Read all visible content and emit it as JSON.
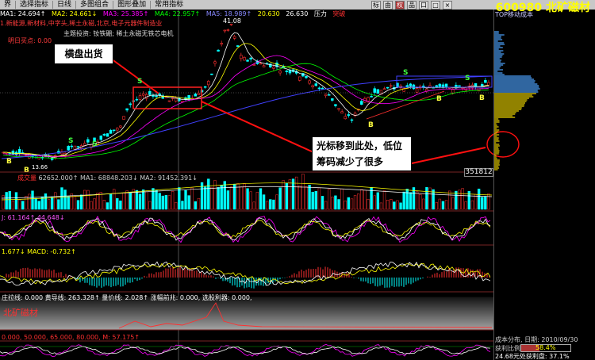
{
  "toolbar": {
    "items": [
      "界",
      "选择指标",
      "日线",
      "多图组合",
      "图形叠加",
      "常用指标"
    ],
    "right_buttons": [
      "标",
      "由",
      "权",
      "品",
      "口",
      "□",
      "×"
    ]
  },
  "stock": {
    "code_name": "600980 北矿磁材"
  },
  "ma_line": {
    "ma1": "MA1: 24.694↑",
    "ma2": "MA2: 24.661↓",
    "ma3": "MA3: 25.385↑",
    "ma4": "MA4: 22.957↑",
    "ma5": "MA5: 18.989↑",
    "v6": "20.630",
    "v7": "26.630",
    "pressure": "压力",
    "signal": "突破"
  },
  "concepts": {
    "line1": "1.新能源,新材料,中字头,稀土永磁,北京,电子元器件制造业",
    "line2": "主题投资: 钕铁硼; 稀土永磁无铁芯电机",
    "line3": "明日买点: 0.00"
  },
  "price_labels": {
    "high": "41.08",
    "low_left": "13.66"
  },
  "callouts": {
    "box_label": "横盘出货",
    "note": "光标移到此处，低位筹码减少了很多"
  },
  "volume": {
    "label": "成交量",
    "values": "62652.000↑   MA1: 68848.203↓   MA2: 91452.391↓",
    "badge": "351812"
  },
  "kdj": {
    "label": "J: 61.164↑  44.648↓"
  },
  "macd": {
    "label": "1.677↓  MACD: -0.732↑"
  },
  "bottom_indicator": {
    "label": "庄拉线: 0.000   黄导线: 263.328↑   量价线: 2.028↑   涨幅前兆: 0.000,   选股利器: 0.000,"
  },
  "bottom_name": "北矿磁材",
  "last_indicator": {
    "label": "0.000,   50.000,   65.000,   80.000,   M: 57.175↑"
  },
  "right_panel": {
    "title": "TOP移动成本",
    "dist_label": "成本分布, 日期: 2010/09/30",
    "profit_label": "获利比例",
    "profit_value": "58.4%",
    "cost_line": "24.68元处获利盘: 37.1%"
  },
  "profit_ratio": 0.371,
  "colors": {
    "up": "#ff3030",
    "down": "#00ffff",
    "ma1": "#ffffff",
    "ma2": "#ffff00",
    "ma3": "#ff00ff",
    "ma4": "#00ff00",
    "ma5": "#4040ff"
  }
}
